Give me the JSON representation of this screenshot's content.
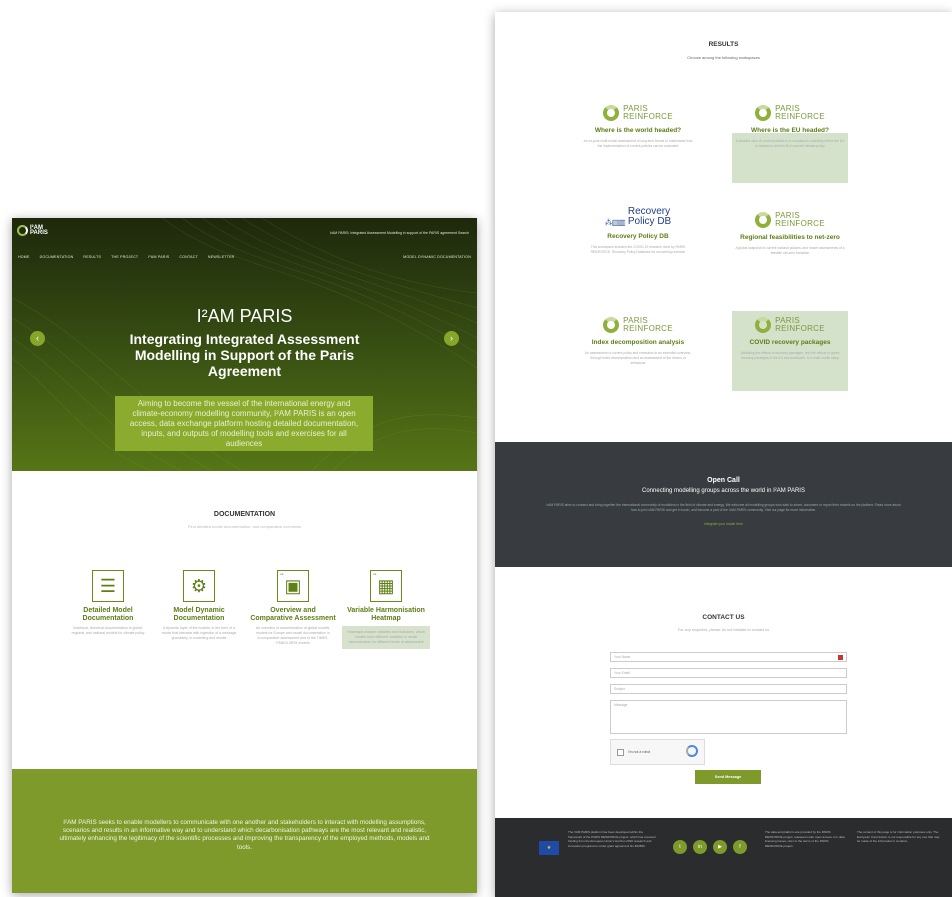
{
  "left": {
    "logo": {
      "line1": "I²AM",
      "line2": "PARIS"
    },
    "top_info": "I²AM PARIS: Integrated Assessment Modelling in support of the PARIS agreement   Search",
    "nav": [
      "HOME",
      "DOCUMENTATION",
      "RESULTS",
      "THE PROJECT",
      "I²AM PARIS",
      "CONTACT",
      "NEWSLETTER"
    ],
    "nav_right": "MODEL DYNAMIC DOCUMENTATION",
    "hero": {
      "title": "I²AM PARIS",
      "subtitle": "Integrating Integrated Assessment Modelling in Support of the Paris Agreement",
      "description": "Aiming to become the vessel of the international energy and climate-economy modelling community, I²AM PARIS is an open access, data exchange platform hosting detailed documentation, inputs, and outputs of modelling tools and exercises for all audiences",
      "prev": "‹",
      "next": "›"
    },
    "documentation": {
      "heading": "DOCUMENTATION",
      "subheading": "Find detailed model documentation, and comparative overviews",
      "cards": [
        {
          "title": "Detailed Model Documentation",
          "text": "Individual, technical documentation of global, regional, and national models for climate policy"
        },
        {
          "title": "Model Dynamic Documentation",
          "text": "A dynamic layer of the models, in the form of a model that interacts with ingestion of a message granularity, in modelling and results"
        },
        {
          "title": "Overview and Comparative Assessment",
          "text": "An overview of documentation of global models, models for Europe and model documentation in a comparative assessment and of the TIMES-PANEU-MFM models"
        },
        {
          "title": "Variable Harmonisation Heatmap",
          "text": "Heatmaps analyse variables and indicators, which models have different variables in model harmonisation, for different levels of assessment"
        }
      ]
    },
    "about": "I²AM PARIS seeks to enable modellers to communicate with one another and stakeholders to interact with modelling assumptions, scenarios and results in an informative way and to understand which decarbonisation pathways are the most relevant and realistic, ultimately enhancing the legitimacy of the scientific processes and improving the transparency of the employed methods, models and tools."
  },
  "right": {
    "results": {
      "heading": "RESULTS",
      "subheading": "Choose among the following workspaces",
      "brand_line1": "PARIS",
      "brand_line2": "REINFORCE",
      "recovery_line1": "Recovery",
      "recovery_line2": "Policy DB",
      "workspaces": [
        {
          "title": "Where is the world headed?",
          "text": "An ex-post multi-model assessment of long term trends to understand how the implementation of current policies can be evaluated",
          "logo": "paris-reinforce"
        },
        {
          "title": "Where is the EU headed?",
          "text": "A detailed view of current policies in a comparison, including where the EU is headed to and the EU's current climate policy",
          "logo": "paris-reinforce"
        },
        {
          "title": "Recovery Policy DB",
          "text": "This workspace includes the COVID-19 research done by PARIS REINFORCE, Recovery Policy Database for recovering research",
          "logo": "recovery-policy-db"
        },
        {
          "title": "Regional feasibilities to net-zero",
          "text": "A global snapshot of current national policies, and model assessments of a feasible net-zero transition",
          "logo": "paris-reinforce"
        },
        {
          "title": "Index decomposition analysis",
          "text": "An assessment of current policy and emissions in an extended overview, through index decomposition and an assessment of the drivers of emissions",
          "logo": "paris-reinforce"
        },
        {
          "title": "COVID recovery packages",
          "text": "Modelling the effects of recovery packages, and the effects of green recovery packages in the EU and worldwide, in a multi-model setup",
          "logo": "paris-reinforce"
        }
      ]
    },
    "open_call": {
      "heading": "Open Call",
      "subheading": "Connecting modelling groups across the world in I²AM PARIS",
      "text": "I²AM PARIS aims to connect and bring together the international community of modellers in the field of climate and energy. We welcome all modelling groups who wish to share, document or report their models on the platform. Read more about how to join I²AM PARIS and get in touch, and become a part of the I²AM PARIS community. Visit our page for more information.",
      "link": "Integrate your model here"
    },
    "contact": {
      "heading": "CONTACT US",
      "subheading": "For any enquiries, please do not hesitate to contact us",
      "fields": [
        "Your Name",
        "Your Email",
        "Subject",
        "Message"
      ],
      "captcha_label": "I'm not a robot",
      "send": "Send Message"
    },
    "footer": {
      "eu_flag": "★",
      "funding_text": "The I²AM PARIS platform has been developed within the framework of the PARIS REINFORCE project, which has received funding from the European Union's Horizon 2020 research and innovation programme under grant agreement No 820846.",
      "social": [
        "t",
        "in",
        "▶",
        "f"
      ],
      "middle_text": "The data and platform are provided by the PARIS REINFORCE project, released under open access. For data licensing issues, refer to the terms of the PARIS REINFORCE project.",
      "right_text": "The content of this page is for information purposes only. The European Commission is not responsible for any use that may be made of the information it contains."
    }
  }
}
